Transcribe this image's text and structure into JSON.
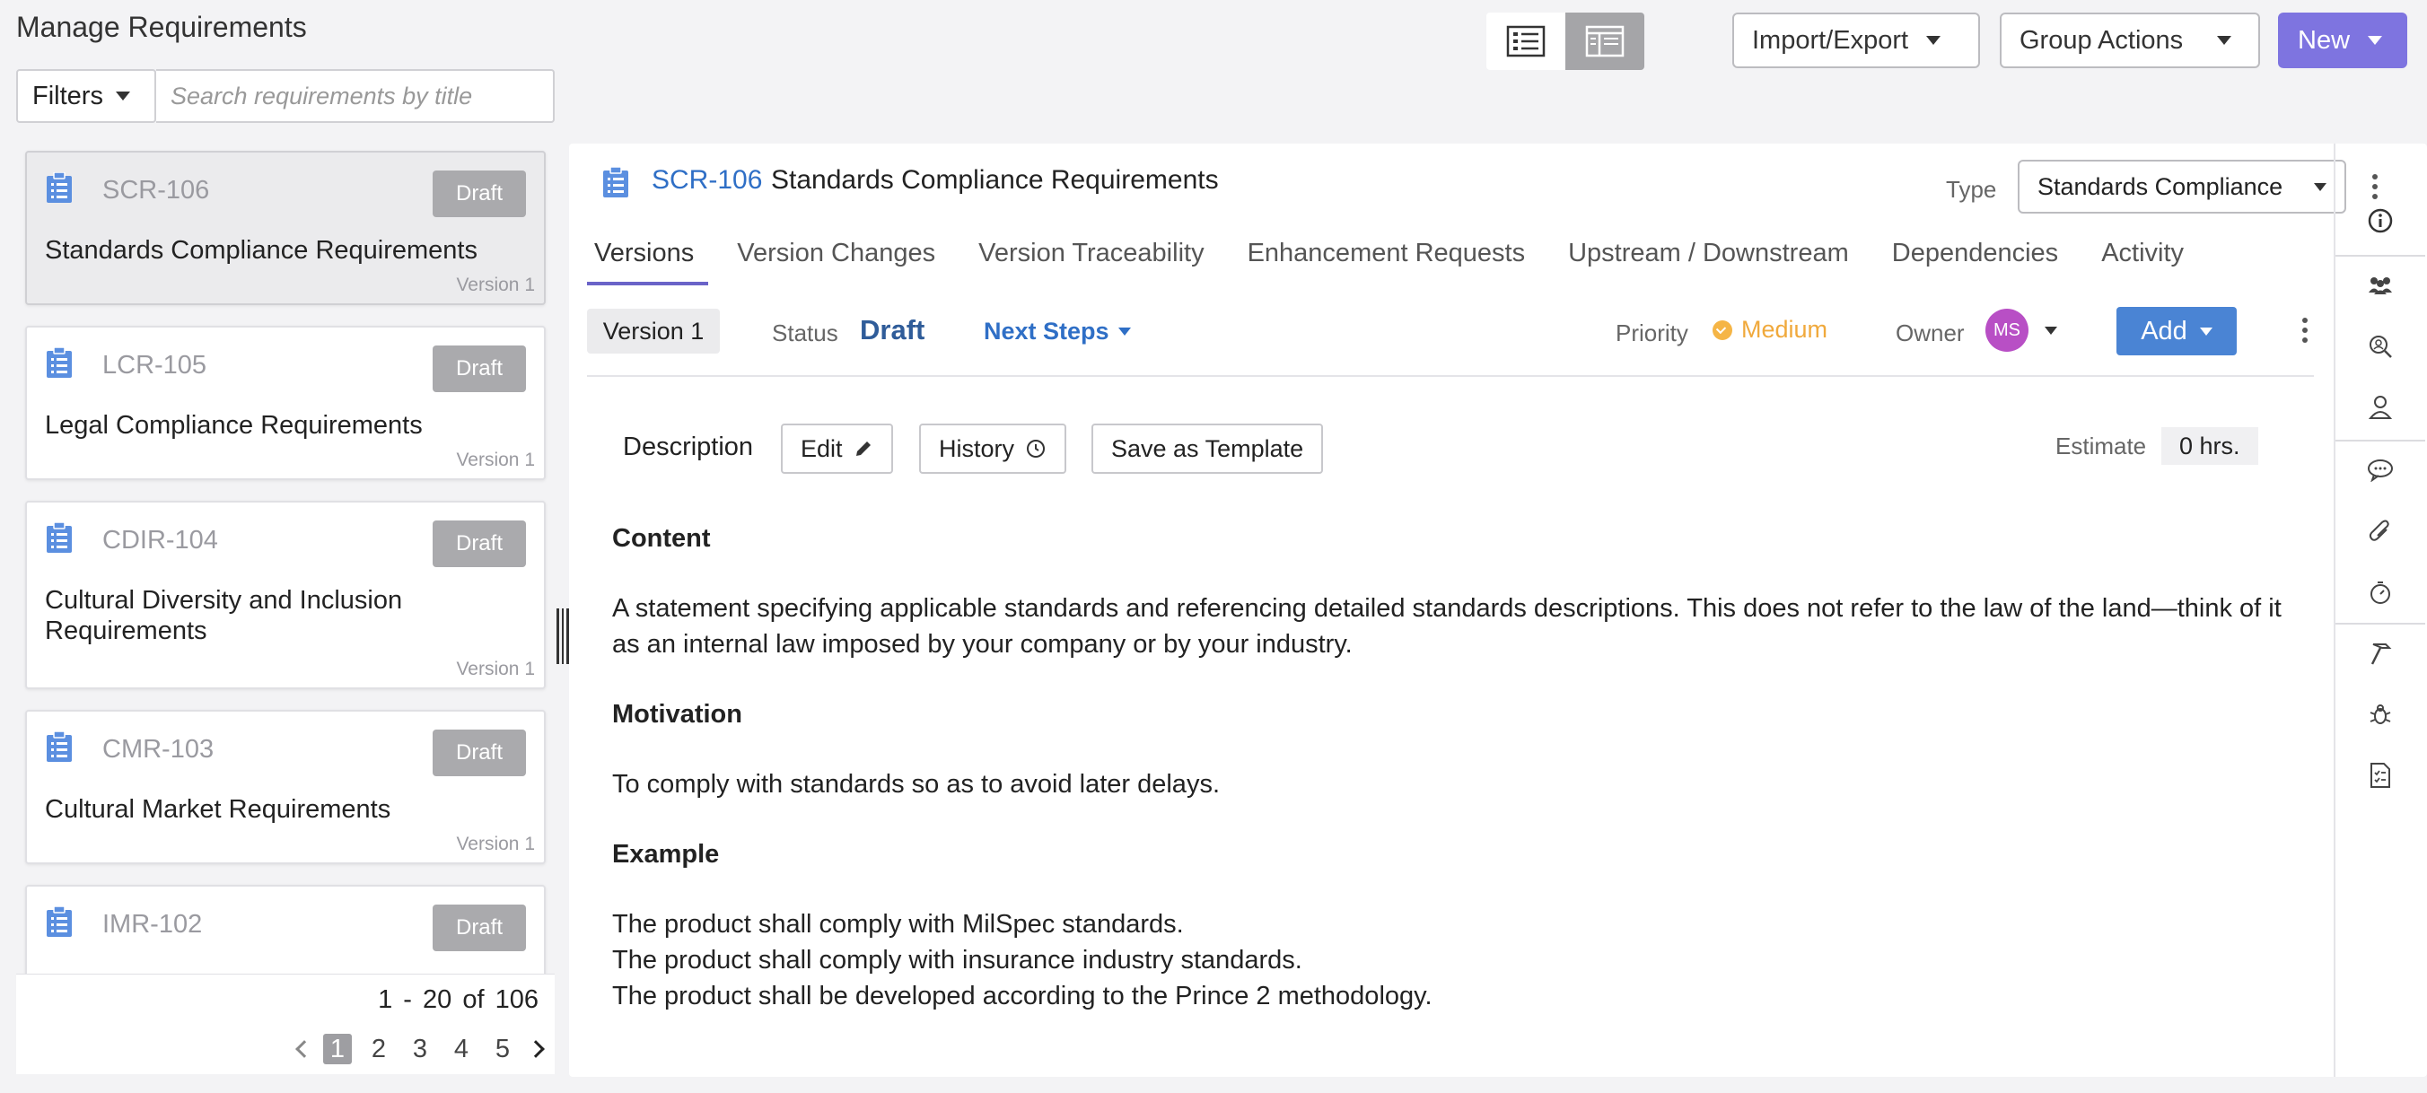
{
  "page": {
    "title": "Manage Requirements"
  },
  "toolbar": {
    "filters_label": "Filters",
    "search_placeholder": "Search requirements by title",
    "import_export_label": "Import/Export",
    "group_actions_label": "Group Actions",
    "new_label": "New"
  },
  "requirements": [
    {
      "id": "SCR-106",
      "status": "Draft",
      "title": "Standards Compliance Requirements",
      "version": "Version 1",
      "selected": true
    },
    {
      "id": "LCR-105",
      "status": "Draft",
      "title": "Legal Compliance Requirements",
      "version": "Version 1"
    },
    {
      "id": "CDIR-104",
      "status": "Draft",
      "title": "Cultural Diversity and Inclusion Requirements",
      "version": "Version 1"
    },
    {
      "id": "CMR-103",
      "status": "Draft",
      "title": "Cultural Market Requirements",
      "version": "Version 1"
    },
    {
      "id": "IMR-102",
      "status": "Draft",
      "title": "",
      "version": ""
    }
  ],
  "pagination": {
    "range": "1 - 20",
    "of_label": "of",
    "total": "106",
    "pages": [
      "1",
      "2",
      "3",
      "4",
      "5"
    ],
    "current": "1"
  },
  "detail": {
    "id": "SCR-106",
    "title": "Standards Compliance Requirements",
    "type_label": "Type",
    "type_value": "Standards Compliance",
    "tabs": [
      "Versions",
      "Version Changes",
      "Version Traceability",
      "Enhancement Requests",
      "Upstream / Downstream",
      "Dependencies",
      "Activity"
    ],
    "active_tab": "Versions",
    "version": "Version 1",
    "status_label": "Status",
    "status_value": "Draft",
    "next_steps_label": "Next Steps",
    "priority_label": "Priority",
    "priority_value": "Medium",
    "priority_color": "#f0a93c",
    "owner_label": "Owner",
    "owner_initials": "MS",
    "owner_color": "#b84fc5",
    "add_label": "Add",
    "description_label": "Description",
    "edit_label": "Edit",
    "history_label": "History",
    "save_template_label": "Save as Template",
    "estimate_label": "Estimate",
    "estimate_value": "0 hrs.",
    "content": {
      "h1": "Content",
      "p1": "A statement specifying applicable standards and referencing detailed standards descriptions. This does not refer to the law of the land—think of it as an internal law imposed by your company or by your industry.",
      "h2": "Motivation",
      "p2": "To comply with standards so as to avoid later delays.",
      "h3": "Example",
      "lines": [
        "The product shall comply with MilSpec standards.",
        "The product shall comply with insurance industry standards.",
        "The product shall be developed according to the Prince 2 methodology."
      ]
    }
  },
  "rail_icons": [
    "info-icon",
    "team-icon",
    "search-zoom-icon",
    "user-icon",
    "comments-icon",
    "attachment-icon",
    "timer-icon",
    "hammer-icon",
    "bug-icon",
    "checklist-icon"
  ],
  "colors": {
    "accent": "#7e74e0",
    "link": "#2f6fc6",
    "add_button": "#4a84d4",
    "draft_badge": "#aaaaad"
  }
}
